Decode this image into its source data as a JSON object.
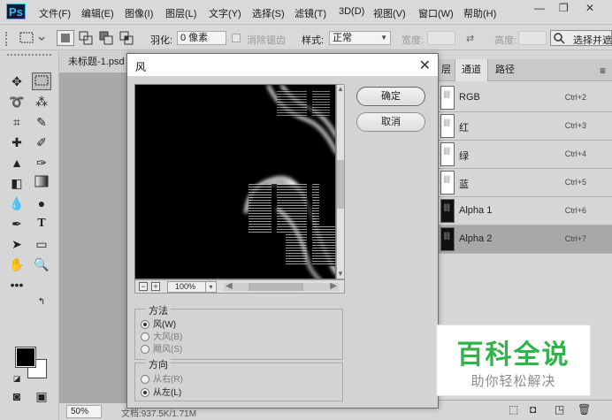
{
  "app": {
    "logo": "Ps"
  },
  "menu": {
    "items": [
      "文件(F)",
      "编辑(E)",
      "图像(I)",
      "图层(L)",
      "文字(Y)",
      "选择(S)",
      "滤镜(T)",
      "3D(D)",
      "视图(V)",
      "窗口(W)",
      "帮助(H)"
    ]
  },
  "window_controls": {
    "minimize": "—",
    "restore": "❐",
    "close": "✕"
  },
  "options_bar": {
    "feather_label": "羽化:",
    "feather_value": "0 像素",
    "antialias_label": "消除锯齿",
    "style_label": "样式:",
    "style_value": "正常",
    "width_label": "宽度:",
    "height_label": "高度:",
    "select_and_mask": "选择并遮"
  },
  "document": {
    "tab_title": "未标题-1.psd",
    "zoom": "50%",
    "info": "文档:937.5K/1.71M"
  },
  "channels_panel": {
    "tabs": [
      "层",
      "通道",
      "路径"
    ],
    "active_tab": "通道",
    "channels": [
      {
        "name": "RGB",
        "shortcut": "Ctrl+2",
        "thumb": "light"
      },
      {
        "name": "红",
        "shortcut": "Ctrl+3",
        "thumb": "light"
      },
      {
        "name": "绿",
        "shortcut": "Ctrl+4",
        "thumb": "light"
      },
      {
        "name": "蓝",
        "shortcut": "Ctrl+5",
        "thumb": "light"
      },
      {
        "name": "Alpha 1",
        "shortcut": "Ctrl+6",
        "thumb": "dark"
      },
      {
        "name": "Alpha 2",
        "shortcut": "Ctrl+7",
        "thumb": "dark",
        "selected": true
      }
    ]
  },
  "dialog": {
    "title": "风",
    "ok_label": "确定",
    "cancel_label": "取消",
    "preview_zoom": "100%",
    "method": {
      "label": "方法",
      "options": [
        "风(W)",
        "大风(B)",
        "飓风(S)"
      ],
      "selected": "风(W)"
    },
    "direction": {
      "label": "方向",
      "options": [
        "从右(R)",
        "从左(L)"
      ],
      "selected": "从左(L)"
    }
  },
  "watermark": {
    "title": "百科全说",
    "subtitle": "助你轻松解决",
    "title_color": "#2fb34a",
    "subtitle_color": "#8c8c8c"
  },
  "colors": {
    "foreground": "#000000",
    "background": "#ffffff",
    "ui_bg": "#d6d6d6",
    "selected_row": "#a8a8a8"
  }
}
